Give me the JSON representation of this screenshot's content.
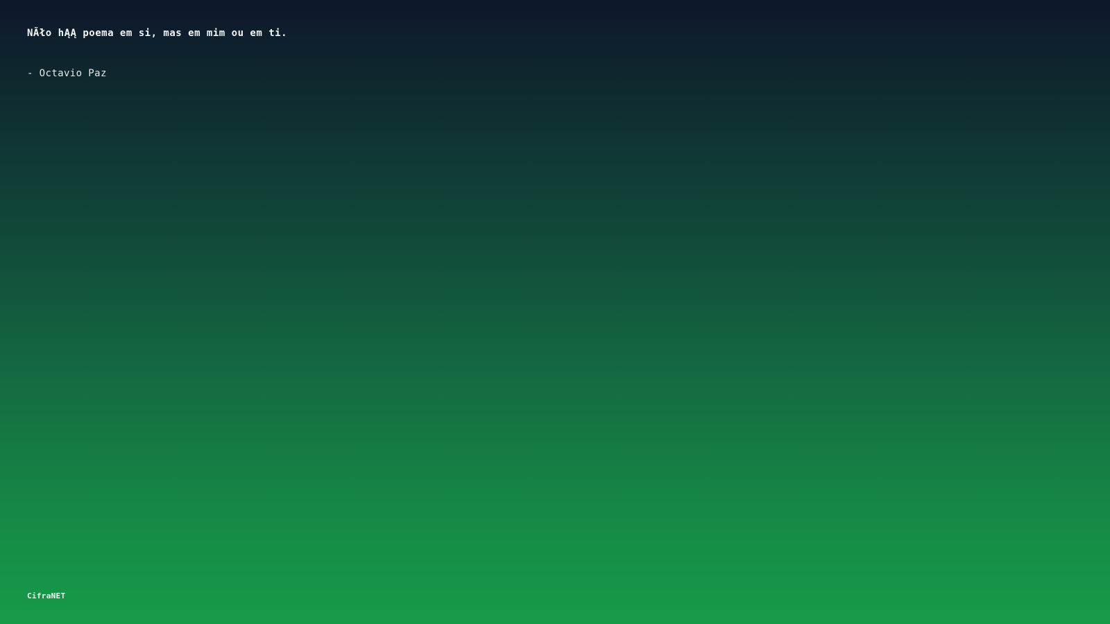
{
  "quote": {
    "text": "NÃło hĄĄ poema em si, mas em mim ou em ti.",
    "author": "- Octavio Paz"
  },
  "brand": {
    "name": "CifraNET"
  },
  "colors": {
    "background_top": "#0e172b",
    "background_bottom": "#169b48",
    "text": "#f4f7f5"
  }
}
